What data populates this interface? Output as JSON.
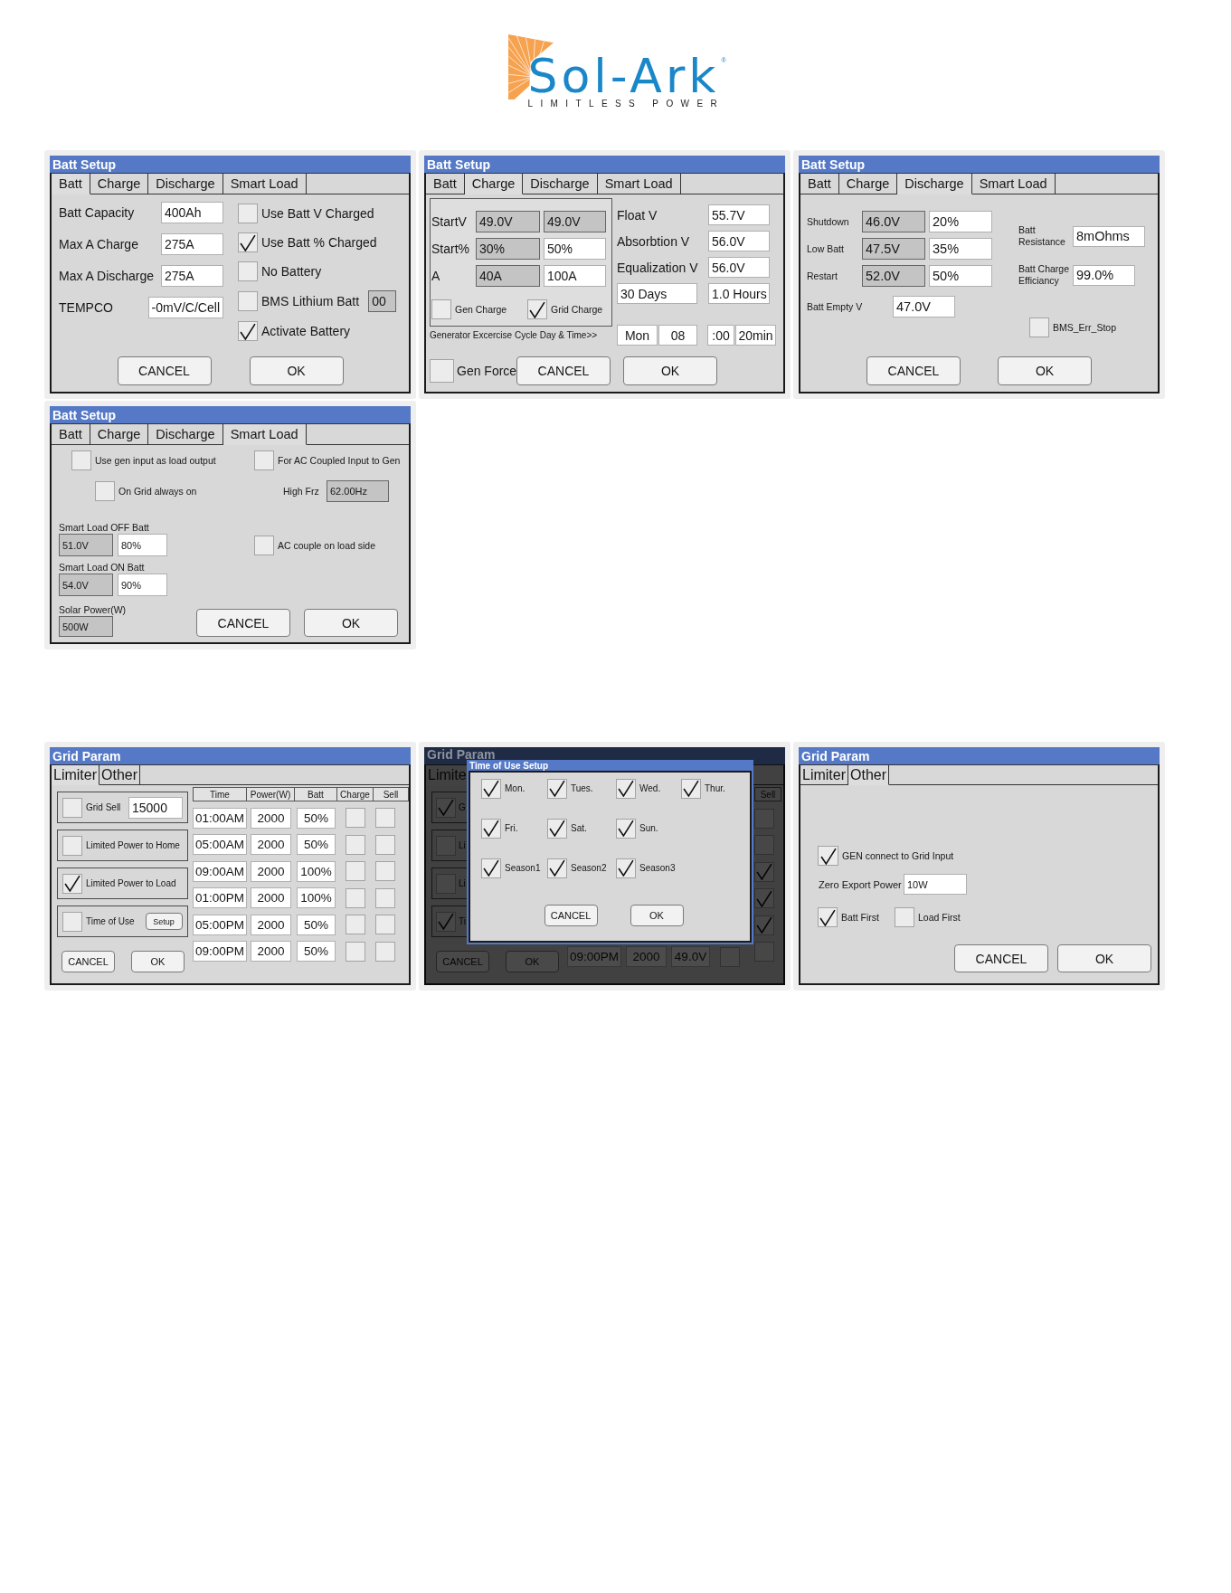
{
  "logo": {
    "brand": "Sol-Ark",
    "registered": "®",
    "tagline": "LIMITLESS POWER"
  },
  "groups": [
    {
      "screens": [
        {
          "kind": "batt",
          "title": "Batt Setup",
          "tabs": [
            {
              "label": "Batt",
              "selected": true
            },
            {
              "label": "Charge",
              "selected": false
            },
            {
              "label": "Discharge",
              "selected": false
            },
            {
              "label": "Smart Load",
              "selected": false
            }
          ],
          "fields": [
            {
              "label": "Batt Capacity",
              "value": "400Ah"
            },
            {
              "label": "Max A Charge",
              "value": "275A"
            },
            {
              "label": "Max A Discharge",
              "value": "275A"
            },
            {
              "label": "TEMPCO",
              "value": "-0mV/C/Cell"
            }
          ],
          "options": [
            {
              "label": "Use Batt V Charged",
              "checked": false
            },
            {
              "label": "Use Batt % Charged",
              "checked": true
            },
            {
              "label": "No Battery",
              "checked": false
            },
            {
              "label": "BMS Lithium Batt",
              "checked": false,
              "field": {
                "value": "00",
                "disabled": true
              }
            },
            {
              "label": "Activate Battery",
              "checked": true
            }
          ],
          "buttons": [
            "CANCEL",
            "OK"
          ]
        },
        {
          "kind": "charge",
          "title": "Batt Setup",
          "tabs": [
            {
              "label": "Batt",
              "selected": false
            },
            {
              "label": "Charge",
              "selected": true
            },
            {
              "label": "Discharge",
              "selected": false
            },
            {
              "label": "Smart Load",
              "selected": false
            }
          ],
          "start_rows": [
            {
              "label": "StartV",
              "fields": [
                {
                  "value": "49.0V",
                  "disabled": true
                },
                {
                  "value": "49.0V",
                  "disabled": true
                }
              ]
            },
            {
              "label": "Start%",
              "fields": [
                {
                  "value": "30%",
                  "disabled": true
                },
                {
                  "value": "50%",
                  "disabled": false
                }
              ]
            },
            {
              "label": "A",
              "fields": [
                {
                  "value": "40A",
                  "disabled": true
                },
                {
                  "value": "100A",
                  "disabled": false
                }
              ]
            }
          ],
          "group_options": [
            {
              "label": "Gen Charge",
              "checked": false
            },
            {
              "label": "Grid Charge",
              "checked": true
            }
          ],
          "voltages": [
            {
              "label": "Float V",
              "value": "55.7V"
            },
            {
              "label": "Absorbtion V",
              "value": "56.0V"
            },
            {
              "label": "Equalization V",
              "value": "56.0V"
            }
          ],
          "equalization": [
            "30 Days",
            "1.0 Hours"
          ],
          "exercise": {
            "label": "Generator Excercise Cycle Day & Time>>",
            "day": "Mon",
            "hour": "08",
            "minute": ":00",
            "duration": "20min"
          },
          "gen_force": {
            "label": "Gen Force",
            "checked": false
          },
          "buttons": [
            "CANCEL",
            "OK"
          ]
        },
        {
          "kind": "discharge",
          "title": "Batt Setup",
          "tabs": [
            {
              "label": "Batt",
              "selected": false
            },
            {
              "label": "Charge",
              "selected": false
            },
            {
              "label": "Discharge",
              "selected": true
            },
            {
              "label": "Smart Load",
              "selected": false
            }
          ],
          "levels": [
            {
              "label": "Shutdown",
              "fields": [
                {
                  "value": "46.0V",
                  "disabled": true
                },
                {
                  "value": "20%",
                  "disabled": false
                }
              ]
            },
            {
              "label": "Low Batt",
              "fields": [
                {
                  "value": "47.5V",
                  "disabled": true
                },
                {
                  "value": "35%",
                  "disabled": false
                }
              ]
            },
            {
              "label": "Restart",
              "fields": [
                {
                  "value": "52.0V",
                  "disabled": true
                },
                {
                  "value": "50%",
                  "disabled": false
                }
              ]
            }
          ],
          "empty_voltage": {
            "label": "Batt Empty V",
            "value": "47.0V"
          },
          "battery": [
            {
              "label": "Batt Resistance",
              "value": "8mOhms"
            },
            {
              "label": "Batt Charge Efficiancy",
              "value": "99.0%"
            }
          ],
          "bms_err_stop": {
            "label": "BMS_Err_Stop",
            "checked": false
          },
          "buttons": [
            "CANCEL",
            "OK"
          ]
        },
        {
          "kind": "smart_load",
          "title": "Batt Setup",
          "tabs": [
            {
              "label": "Batt",
              "selected": false
            },
            {
              "label": "Charge",
              "selected": false
            },
            {
              "label": "Discharge",
              "selected": false
            },
            {
              "label": "Smart Load",
              "selected": true
            }
          ],
          "gen_input": {
            "label": "Use gen input as load output",
            "checked": false
          },
          "ac_coupled_gen": {
            "label": "For AC Coupled Input to Gen",
            "checked": false
          },
          "on_grid_always_on": {
            "label": "On Grid always on",
            "checked": false
          },
          "high_frz": {
            "label": "High Frz",
            "value": "62.00Hz",
            "disabled": true
          },
          "off_batt": {
            "label": "Smart Load OFF Batt",
            "fields": [
              {
                "value": "51.0V",
                "disabled": true
              },
              {
                "value": "80%",
                "disabled": false
              }
            ]
          },
          "ac_couple_load_side": {
            "label": "AC couple on load side",
            "checked": false
          },
          "on_batt": {
            "label": "Smart Load ON Batt",
            "fields": [
              {
                "value": "54.0V",
                "disabled": true
              },
              {
                "value": "90%",
                "disabled": false
              }
            ]
          },
          "solar_power": {
            "label": "Solar Power(W)",
            "value": "500W",
            "disabled": true
          },
          "buttons": [
            "CANCEL",
            "OK"
          ]
        }
      ]
    },
    {
      "screens": [
        {
          "kind": "limiter",
          "title": "Grid Param",
          "tabs": [
            {
              "label": "Limiter",
              "selected": true
            },
            {
              "label": "Other",
              "selected": false
            }
          ],
          "modes": [
            {
              "label": "Grid Sell",
              "checked": false,
              "value": "15000"
            },
            {
              "label": "Limited Power to Home",
              "checked": false
            },
            {
              "label": "Limited Power to Load",
              "checked": true
            },
            {
              "label": "Time of Use",
              "checked": false,
              "button": "Setup"
            }
          ],
          "schedule": {
            "columns": [
              "Time",
              "Power(W)",
              "Batt",
              "Charge",
              "Sell"
            ],
            "rows": [
              {
                "time": "01:00AM",
                "power": "2000",
                "batt": "50%",
                "charge": false,
                "sell": false
              },
              {
                "time": "05:00AM",
                "power": "2000",
                "batt": "50%",
                "charge": false,
                "sell": false
              },
              {
                "time": "09:00AM",
                "power": "2000",
                "batt": "100%",
                "charge": false,
                "sell": false
              },
              {
                "time": "01:00PM",
                "power": "2000",
                "batt": "100%",
                "charge": false,
                "sell": false
              },
              {
                "time": "05:00PM",
                "power": "2000",
                "batt": "50%",
                "charge": false,
                "sell": false
              },
              {
                "time": "09:00PM",
                "power": "2000",
                "batt": "50%",
                "charge": false,
                "sell": false
              }
            ]
          },
          "buttons": [
            "CANCEL",
            "OK"
          ]
        },
        {
          "kind": "limiter_behind",
          "dimmed": true,
          "title": "Grid Param",
          "tabs": [
            {
              "label": "Limite",
              "selected": true
            }
          ],
          "modes": [
            {
              "label": "G",
              "checked": true
            },
            {
              "label": "Li",
              "checked": false
            },
            {
              "label": "Li",
              "checked": false
            },
            {
              "label": "Ti",
              "checked": true
            }
          ],
          "schedule": {
            "columns": [
              "Sell"
            ],
            "rows": [
              {
                "sell": false
              },
              {
                "sell": false
              },
              {
                "sell": true
              },
              {
                "sell": true
              },
              {
                "sell": true
              },
              {
                "time": "09:00PM",
                "power": "2000",
                "batt": "49.0V",
                "charge": false,
                "sell": false
              }
            ]
          },
          "buttons": [
            "CANCEL",
            "OK"
          ],
          "dialog": {
            "title": "Time of Use Setup",
            "days": [
              {
                "label": "Mon.",
                "checked": true
              },
              {
                "label": "Tues.",
                "checked": true
              },
              {
                "label": "Wed.",
                "checked": true
              },
              {
                "label": "Thur.",
                "checked": true
              },
              {
                "label": "Fri.",
                "checked": true
              },
              {
                "label": "Sat.",
                "checked": true
              },
              {
                "label": "Sun.",
                "checked": true
              }
            ],
            "seasons": [
              {
                "label": "Season1",
                "checked": true
              },
              {
                "label": "Season2",
                "checked": true
              },
              {
                "label": "Season3",
                "checked": true
              }
            ],
            "buttons": [
              "CANCEL",
              "OK"
            ]
          }
        },
        {
          "kind": "other",
          "title": "Grid Param",
          "tabs": [
            {
              "label": "Limiter",
              "selected": false
            },
            {
              "label": "Other",
              "selected": true
            }
          ],
          "gen_connect": {
            "label": "GEN connect to Grid Input",
            "checked": true
          },
          "zero_export": {
            "label": "Zero Export Power",
            "value": "10W"
          },
          "priority": [
            {
              "label": "Batt First",
              "checked": true
            },
            {
              "label": "Load First",
              "checked": false
            }
          ],
          "buttons": [
            "CANCEL",
            "OK"
          ]
        }
      ]
    }
  ]
}
